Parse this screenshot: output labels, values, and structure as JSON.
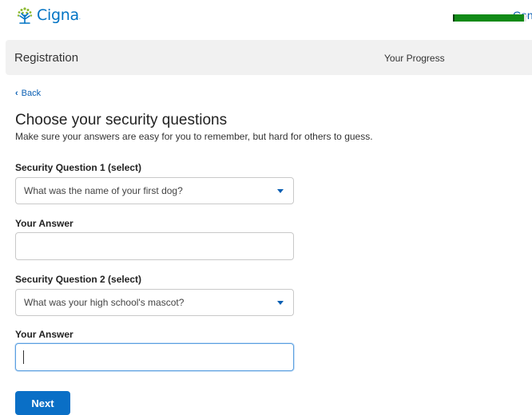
{
  "header": {
    "brand": "Cigna",
    "brand_mark": ".",
    "contact_link": "Con"
  },
  "registration": {
    "title": "Registration",
    "progress_label": "Your Progress",
    "progress_fraction": 0.97
  },
  "nav": {
    "back_label": "Back"
  },
  "form": {
    "heading": "Choose your security questions",
    "subheading": "Make sure your answers are easy for you to remember, but hard for others to guess.",
    "question1_label": "Security Question 1 (select)",
    "question1_value": "What was the name of your first dog?",
    "answer1_label": "Your Answer",
    "answer1_value": "",
    "question2_label": "Security Question 2 (select)",
    "question2_value": "What was your high school's mascot?",
    "answer2_label": "Your Answer",
    "answer2_value": "",
    "next_label": "Next"
  },
  "colors": {
    "brand_blue": "#0073c4",
    "link_blue": "#0a5fb3",
    "progress_green": "#118a17",
    "button_blue": "#0a6fc6"
  }
}
